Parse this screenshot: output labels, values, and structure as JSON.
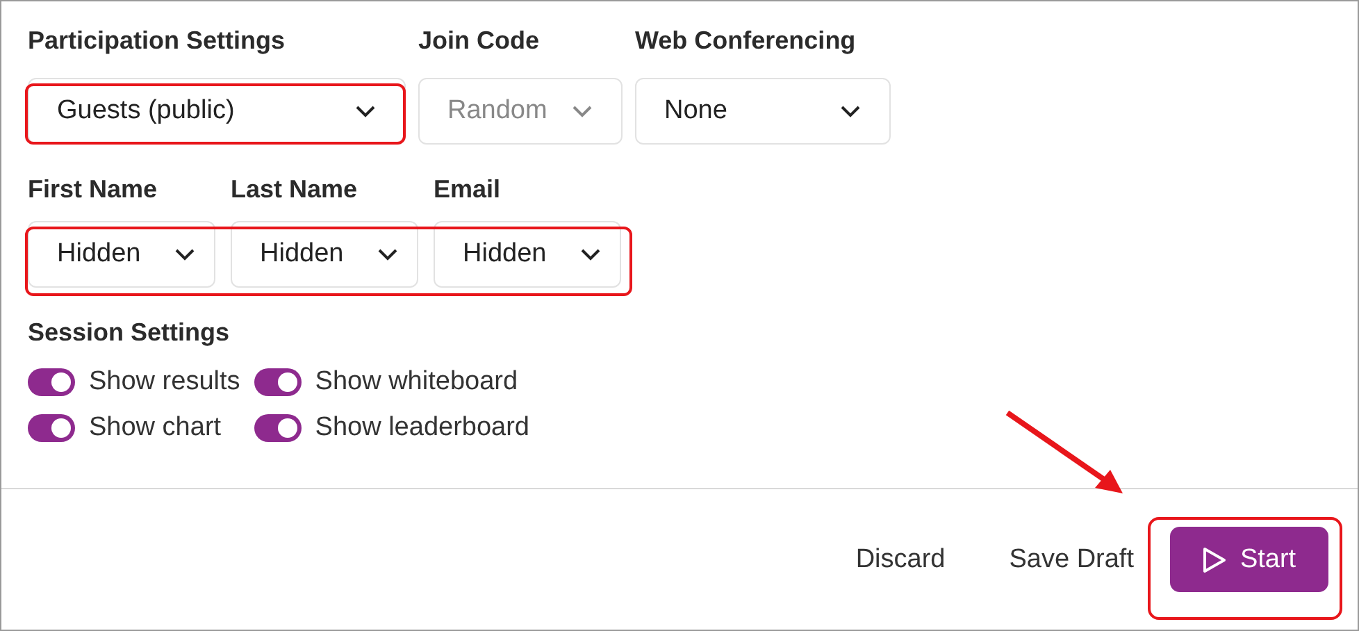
{
  "selects_row_1": [
    {
      "label": "Participation Settings",
      "value": "Guests (public)",
      "disabled": false
    },
    {
      "label": "Join Code",
      "value": "Random",
      "disabled": true
    },
    {
      "label": "Web Conferencing",
      "value": "None",
      "disabled": false
    }
  ],
  "selects_row_2": [
    {
      "label": "First Name",
      "value": "Hidden",
      "disabled": false
    },
    {
      "label": "Last Name",
      "value": "Hidden",
      "disabled": false
    },
    {
      "label": "Email",
      "value": "Hidden",
      "disabled": false
    }
  ],
  "session_settings": {
    "title": "Session Settings",
    "toggles": [
      {
        "label": "Show results",
        "on": true
      },
      {
        "label": "Show whiteboard",
        "on": true
      },
      {
        "label": "Show chart",
        "on": true
      },
      {
        "label": "Show leaderboard",
        "on": true
      }
    ]
  },
  "footer_buttons": [
    {
      "label": "Discard",
      "kind": "text"
    },
    {
      "label": "Save Draft",
      "kind": "text"
    },
    {
      "label": "Start",
      "kind": "primary"
    }
  ]
}
